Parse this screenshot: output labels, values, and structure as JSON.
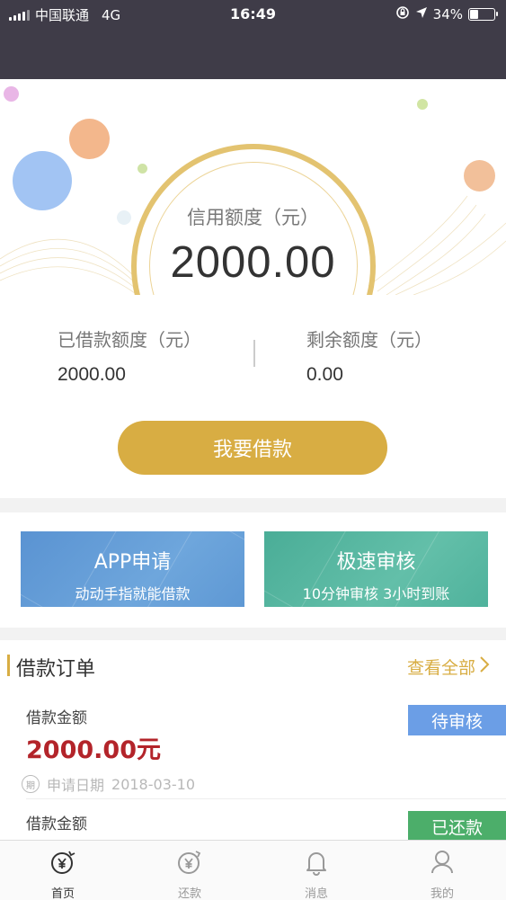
{
  "status_bar": {
    "carrier": "中国联通",
    "network": "4G",
    "time": "16:49",
    "battery": "34%",
    "battery_level": 0.34
  },
  "hero": {
    "credit_label": "信用额度（元）",
    "credit_value": "2000.00"
  },
  "quota": {
    "borrowed_label": "已借款额度（元）",
    "borrowed_value": "2000.00",
    "remaining_label": "剩余额度（元）",
    "remaining_value": "0.00",
    "borrow_button": "我要借款"
  },
  "features": [
    {
      "title": "APP申请",
      "subtitle": "动动手指就能借款"
    },
    {
      "title": "极速审核",
      "subtitle": "10分钟审核 3小时到账"
    }
  ],
  "orders": {
    "title": "借款订单",
    "view_all": "查看全部",
    "items": [
      {
        "amount_label": "借款金额",
        "amount": "2000.00元",
        "status": "待审核",
        "status_color": "#6b9ee6",
        "date_icon_text": "期",
        "date_label": "申请日期",
        "date": "2018-03-10"
      },
      {
        "amount_label": "借款金额",
        "status": "已还款",
        "status_color": "#4cae6a"
      }
    ]
  },
  "tabbar": {
    "items": [
      {
        "label": "首页",
        "icon": "yen-home-icon",
        "active": true
      },
      {
        "label": "还款",
        "icon": "yen-repay-icon",
        "active": false
      },
      {
        "label": "消息",
        "icon": "bell-icon",
        "active": false
      },
      {
        "label": "我的",
        "icon": "user-icon",
        "active": false
      }
    ]
  },
  "colors": {
    "accent": "#d8ad43",
    "topbar": "#3f3c48",
    "amount_red": "#b3242a"
  }
}
